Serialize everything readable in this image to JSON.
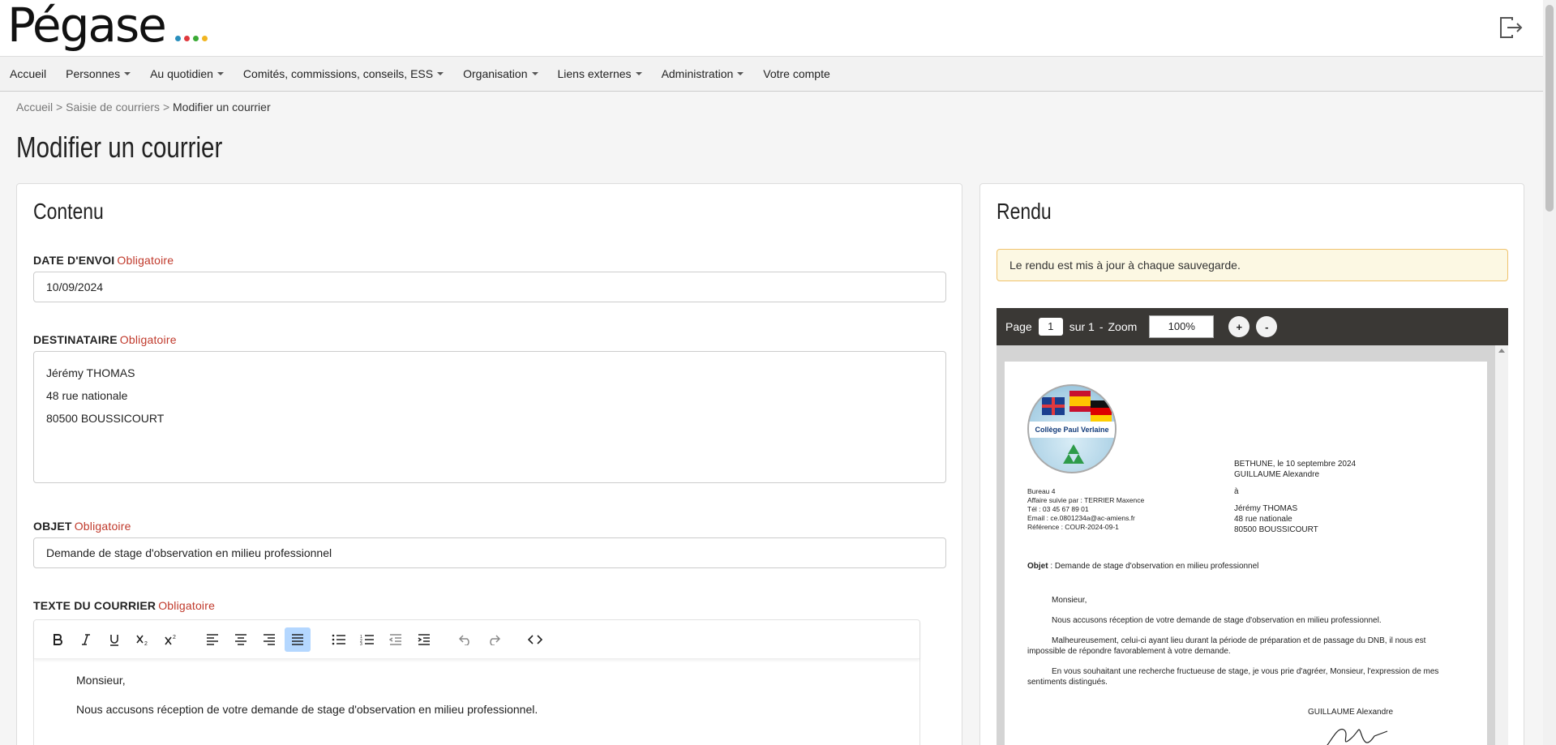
{
  "header": {
    "logo": "Pégase",
    "logo_dot_colors": [
      "#2a8fbd",
      "#e0393e",
      "#3aaa35",
      "#f1b521"
    ],
    "logout_icon": "logout-icon"
  },
  "nav": [
    {
      "label": "Accueil",
      "dropdown": false
    },
    {
      "label": "Personnes",
      "dropdown": true
    },
    {
      "label": "Au quotidien",
      "dropdown": true
    },
    {
      "label": "Comités, commissions, conseils, ESS",
      "dropdown": true
    },
    {
      "label": "Organisation",
      "dropdown": true
    },
    {
      "label": "Liens externes",
      "dropdown": true
    },
    {
      "label": "Administration",
      "dropdown": true
    },
    {
      "label": "Votre compte",
      "dropdown": false
    }
  ],
  "breadcrumb": {
    "home": "Accueil",
    "sep": ">",
    "parent": "Saisie de courriers",
    "current": "Modifier un courrier"
  },
  "page_title": "Modifier un courrier",
  "content": {
    "title": "Contenu",
    "required_label": "Obligatoire",
    "date_label": "DATE D'ENVOI",
    "date_value": "10/09/2024",
    "recipient_label": "DESTINATAIRE",
    "recipient_lines": [
      "Jérémy THOMAS",
      "48 rue nationale",
      "80500 BOUSSICOURT"
    ],
    "subject_label": "OBJET",
    "subject_value": "Demande de stage d'observation en milieu professionnel",
    "body_label": "TEXTE DU COURRIER",
    "body_paragraphs": [
      "Monsieur,",
      "Nous accusons réception de votre demande de stage d'observation en milieu professionnel."
    ]
  },
  "render": {
    "title": "Rendu",
    "info": "Le rendu est mis à jour à chaque sauvegarde.",
    "pdf_bar": {
      "page_label": "Page",
      "page": "1",
      "of_label": "sur 1",
      "dash": "-",
      "zoom_label": "Zoom",
      "zoom": "100%",
      "zoom_in": "+",
      "zoom_out": "-"
    },
    "letter": {
      "seal_text": "Collège Paul Verlaine",
      "sender_lines": [
        "Bureau 4",
        "Affaire suivie par : TERRIER Maxence",
        "Tél : 03 45 67 89 01",
        "Email : ce.0801234a@ac-amiens.fr",
        "Référence : COUR-2024-09-1"
      ],
      "place_date": "BETHUNE, le 10 septembre 2024",
      "author": "GUILLAUME Alexandre",
      "to": "à",
      "recipient_lines": [
        "Jérémy THOMAS",
        "48 rue nationale",
        "80500 BOUSSICOURT"
      ],
      "subject_label": "Objet",
      "subject": " : Demande de stage d'observation en milieu professionnel",
      "paragraphs": [
        "Monsieur,",
        "Nous accusons réception de votre demande de stage d'observation en milieu professionnel.",
        "Malheureusement, celui-ci ayant lieu durant la période de préparation et de passage du DNB, il nous est impossible de répondre favorablement à votre demande.",
        "En vous souhaitant une recherche fructueuse de stage, je vous prie d'agréer, Monsieur, l'expression de mes sentiments distingués."
      ],
      "signature_name": "GUILLAUME Alexandre"
    }
  }
}
